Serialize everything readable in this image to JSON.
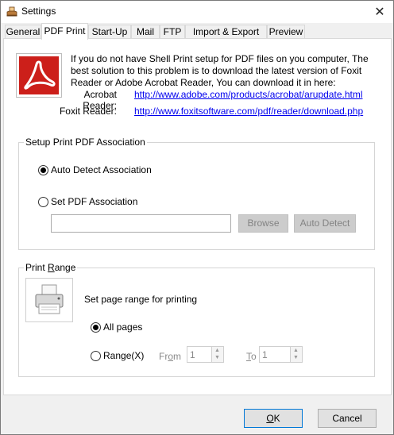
{
  "window": {
    "title": "Settings",
    "close_glyph": "✕"
  },
  "tabs": [
    {
      "label": "General",
      "active": false
    },
    {
      "label": "PDF Print",
      "active": true
    },
    {
      "label": "Start-Up",
      "active": false
    },
    {
      "label": "Mail",
      "active": false
    },
    {
      "label": "FTP",
      "active": false
    },
    {
      "label": "Import & Export",
      "active": false
    },
    {
      "label": "Preview",
      "active": false
    }
  ],
  "info": {
    "message": "If you do not have Shell Print setup for PDF files on you computer, The best solution to this problem is to download the latest version of Foxit Reader or Adobe Acrobat Reader, You can download it in here:",
    "acrobat_label": "Acrobat Reader:",
    "acrobat_link": "http://www.adobe.com/products/acrobat/arupdate.html",
    "foxit_label": "Foxit Reader:",
    "foxit_link": "http://www.foxitsoftware.com/pdf/reader/download.php"
  },
  "association": {
    "title": "Setup Print PDF Association",
    "auto_detect_label": "Auto Detect Association",
    "set_pdf_label": "Set PDF Association",
    "path_value": "",
    "browse_label": "Browse",
    "auto_detect_button": "Auto Detect",
    "selected": "auto"
  },
  "print_range": {
    "title_prefix": "Print ",
    "title_underlined": "R",
    "title_suffix": "ange",
    "description": "Set page range for printing",
    "all_pages_label": "All pages",
    "range_label": "Range(X)",
    "from_prefix": "Fr",
    "from_underlined": "o",
    "from_suffix": "m",
    "from_value": "1",
    "to_underlined": "T",
    "to_suffix": "o",
    "to_value": "1",
    "selected": "all"
  },
  "footer": {
    "ok_underlined": "O",
    "ok_suffix": "K",
    "cancel_label": "Cancel"
  },
  "colors": {
    "accent": "#0078d7",
    "pdf_red": "#cc1f1a",
    "link": "#0000ee"
  }
}
